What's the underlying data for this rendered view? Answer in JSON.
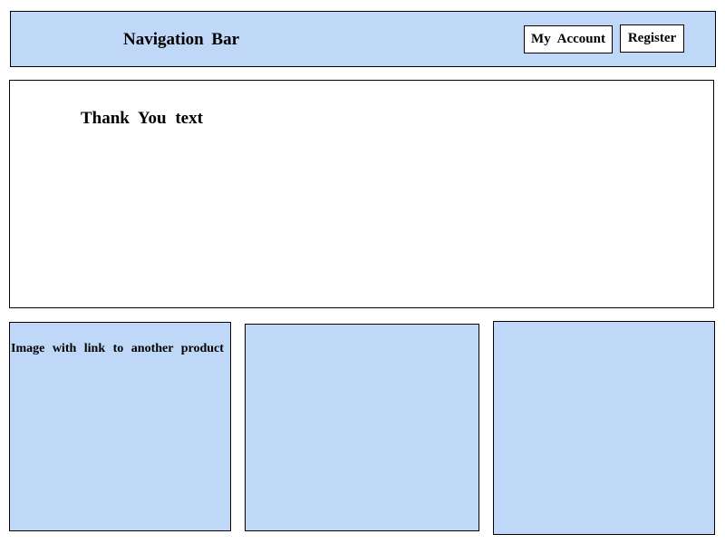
{
  "navbar": {
    "title": "Navigation  Bar",
    "buttons": {
      "my_account": "My  Account",
      "register": "Register"
    }
  },
  "main": {
    "thank_you_text": "Thank  You  text"
  },
  "products": [
    {
      "label": "Image  with  link  to  another  product"
    },
    {
      "label": ""
    },
    {
      "label": ""
    }
  ],
  "colors": {
    "panel_fill": "#c0d8f8",
    "border": "#000000",
    "background": "#ffffff"
  }
}
